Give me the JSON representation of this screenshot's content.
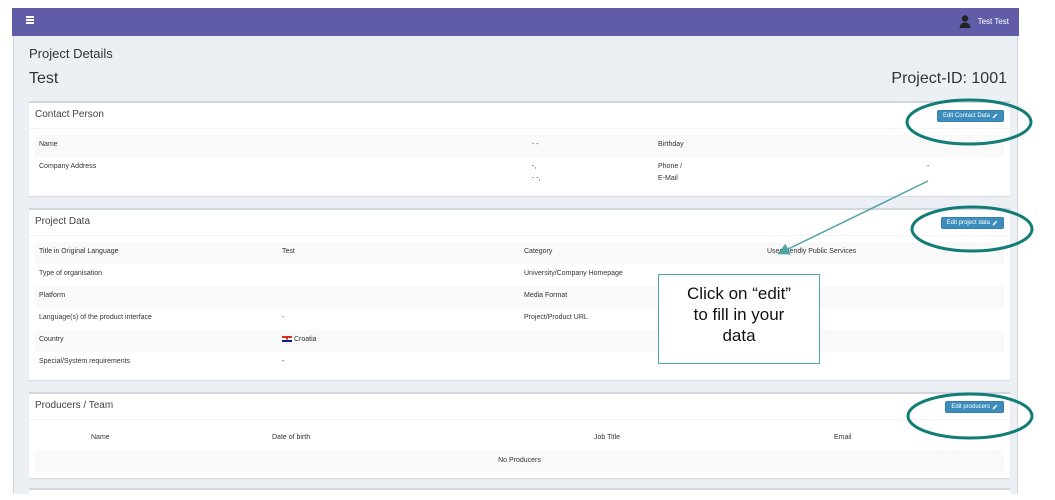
{
  "topbar": {
    "user_name": "Test Test"
  },
  "page": {
    "header": "Project Details",
    "project_name": "Test",
    "project_id": "Project-ID: 1001"
  },
  "contact": {
    "title": "Contact Person",
    "edit_label": "Edit Contact Data",
    "name_label": "Name",
    "name_value": "- -",
    "birthday_label": "Birthday",
    "address_label": "Company Address",
    "address_line1": "-,",
    "address_line2": "- -,",
    "phone_label": "Phone /",
    "email_label": "E-Mail",
    "phone_value": "-"
  },
  "project": {
    "title": "Project Data",
    "edit_label": "Edit project data",
    "rows": [
      {
        "l1": "Title in Original Language",
        "v1": "Test",
        "l2": "Category",
        "v2": "User friendly Public Services"
      },
      {
        "l1": "Type of organisation",
        "v1": "",
        "l2": "University/Company Homepage",
        "v2": ""
      },
      {
        "l1": "Platform",
        "v1": "",
        "l2": "Media Format",
        "v2": ""
      },
      {
        "l1": "Language(s) of the product interface",
        "v1": "-",
        "l2": "Project/Product URL",
        "v2": ""
      },
      {
        "l1": "Country",
        "v1": "Croatia",
        "l2": "",
        "v2": ""
      },
      {
        "l1": "Special/System requirements",
        "v1": "-",
        "l2": "",
        "v2": ""
      }
    ]
  },
  "producers": {
    "title": "Producers / Team",
    "edit_label": "Edit producers",
    "columns": [
      "Name",
      "Date of birth",
      "Job Title",
      "Email"
    ],
    "empty": "No Producers"
  },
  "callout": {
    "line1": "Click on “edit”",
    "line2": "to fill in your",
    "line3": "data"
  },
  "colors": {
    "topbar": "#605ca8",
    "button": "#3c8dbc",
    "annotation": "#127d77"
  },
  "icons": {
    "menu": "hamburger-icon",
    "avatar": "user-avatar-icon",
    "edit": "pencil-icon",
    "flag": "croatia-flag-icon"
  }
}
